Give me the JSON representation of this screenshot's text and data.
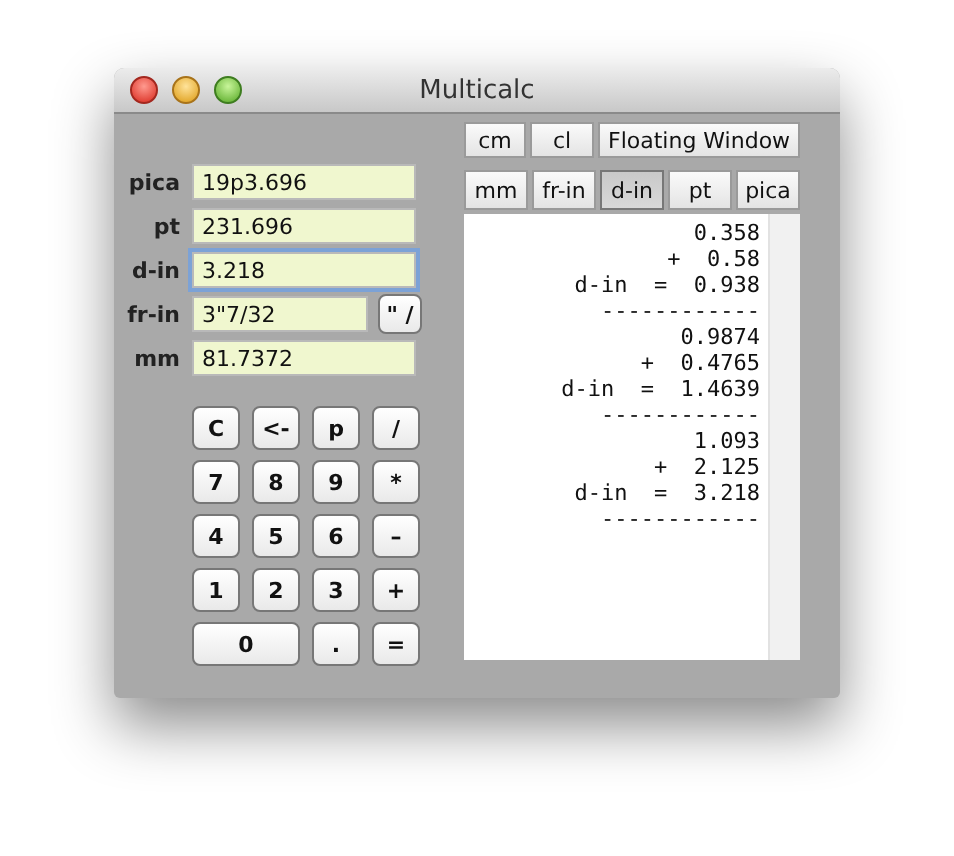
{
  "window": {
    "title": "Multicalc"
  },
  "fields": [
    {
      "label": "pica",
      "value": "19p3.696",
      "focused": false
    },
    {
      "label": "pt",
      "value": "231.696",
      "focused": false
    },
    {
      "label": "d-in",
      "value": "3.218",
      "focused": true
    },
    {
      "label": "fr-in",
      "value": "3\"7/32",
      "focused": false,
      "button": "\" /"
    },
    {
      "label": "mm",
      "value": "81.7372",
      "focused": false
    }
  ],
  "keypad": [
    {
      "label": "C",
      "wide": false
    },
    {
      "label": "<-",
      "wide": false
    },
    {
      "label": "p",
      "wide": false
    },
    {
      "label": "/",
      "wide": false
    },
    {
      "label": "7",
      "wide": false
    },
    {
      "label": "8",
      "wide": false
    },
    {
      "label": "9",
      "wide": false
    },
    {
      "label": "*",
      "wide": false
    },
    {
      "label": "4",
      "wide": false
    },
    {
      "label": "5",
      "wide": false
    },
    {
      "label": "6",
      "wide": false
    },
    {
      "label": "–",
      "wide": false
    },
    {
      "label": "1",
      "wide": false
    },
    {
      "label": "2",
      "wide": false
    },
    {
      "label": "3",
      "wide": false
    },
    {
      "label": "+",
      "wide": false
    },
    {
      "label": "0",
      "wide": true
    },
    {
      "label": ".",
      "wide": false
    },
    {
      "label": "=",
      "wide": false
    }
  ],
  "top_buttons": [
    "cm",
    "cl",
    "Floating Window"
  ],
  "unit_tabs": [
    {
      "label": "mm",
      "selected": false
    },
    {
      "label": "fr-in",
      "selected": false
    },
    {
      "label": "d-in",
      "selected": true
    },
    {
      "label": "pt",
      "selected": false
    },
    {
      "label": "pica",
      "selected": false
    }
  ],
  "tape": [
    [
      "0.358",
      "+  0.58",
      "d-in  =  0.938",
      "------------"
    ],
    [
      "0.9874",
      "+  0.4765",
      "d-in  =  1.4639",
      "------------"
    ],
    [
      "1.093",
      "+  2.125",
      "d-in  =  3.218",
      "------------"
    ]
  ]
}
